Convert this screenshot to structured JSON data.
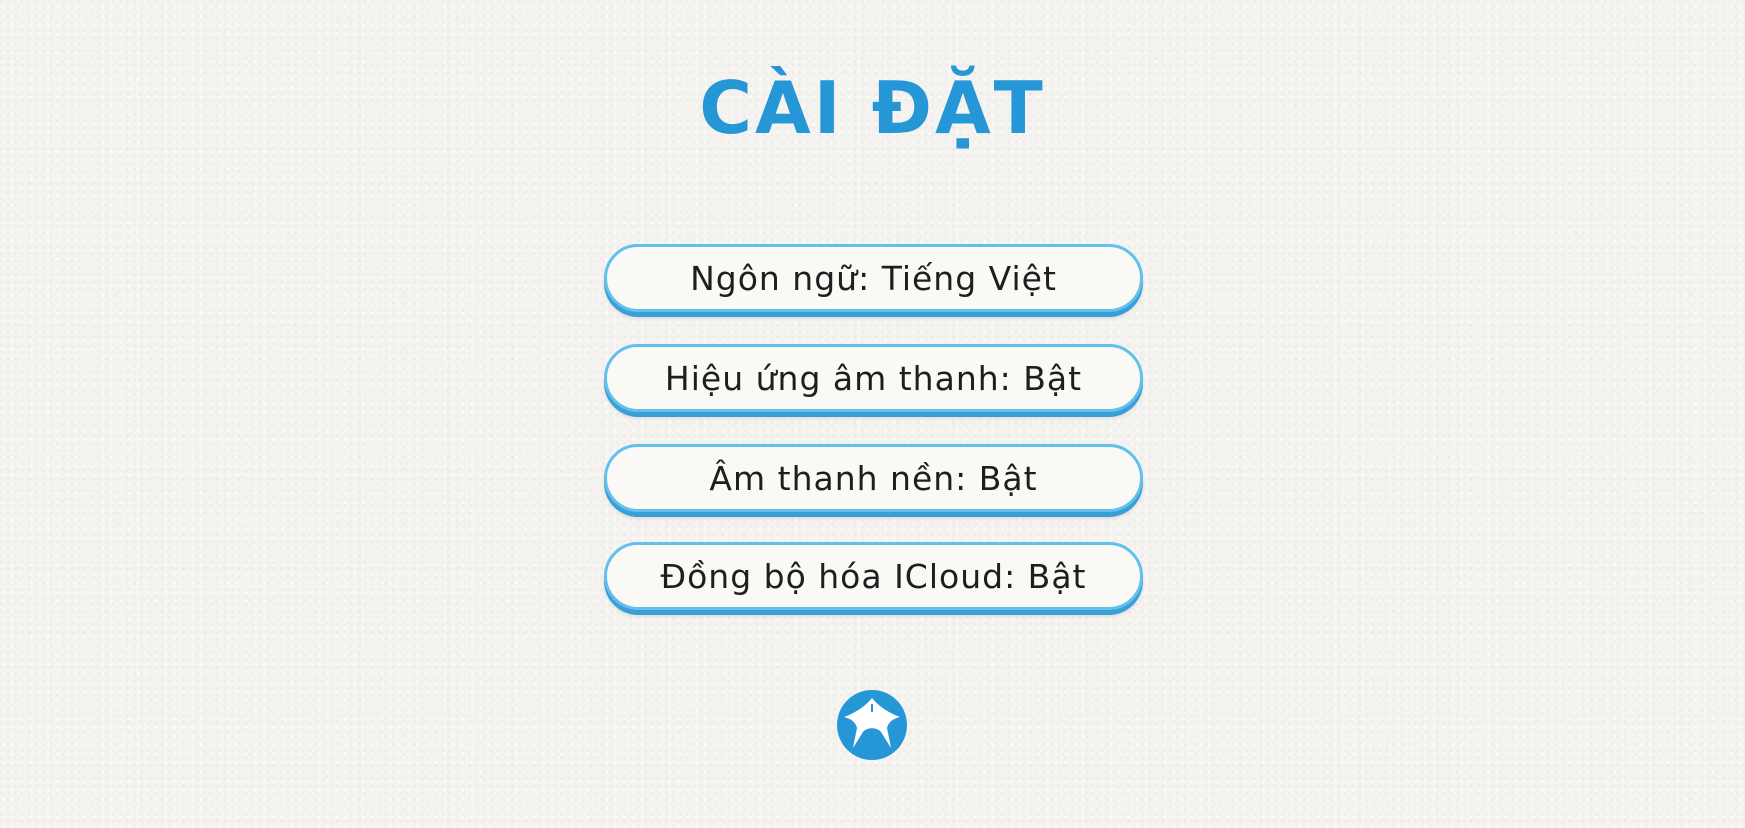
{
  "screen": {
    "title": "CÀI ĐẶT"
  },
  "settings": {
    "items": [
      {
        "label": "Ngôn ngữ: Tiếng Việt"
      },
      {
        "label": "Hiệu ứng âm thanh: Bật"
      },
      {
        "label": "Âm thanh nền: Bật"
      },
      {
        "label": "Đồng bộ hóa ICloud: Bật"
      }
    ]
  },
  "home_button": {
    "icon": "home-icon"
  },
  "colors": {
    "accent": "#2597d6",
    "button_border": "#62c0ec",
    "button_fill": "#faf9f6",
    "text": "#1e1e1e",
    "background": "#f5f3f0"
  }
}
